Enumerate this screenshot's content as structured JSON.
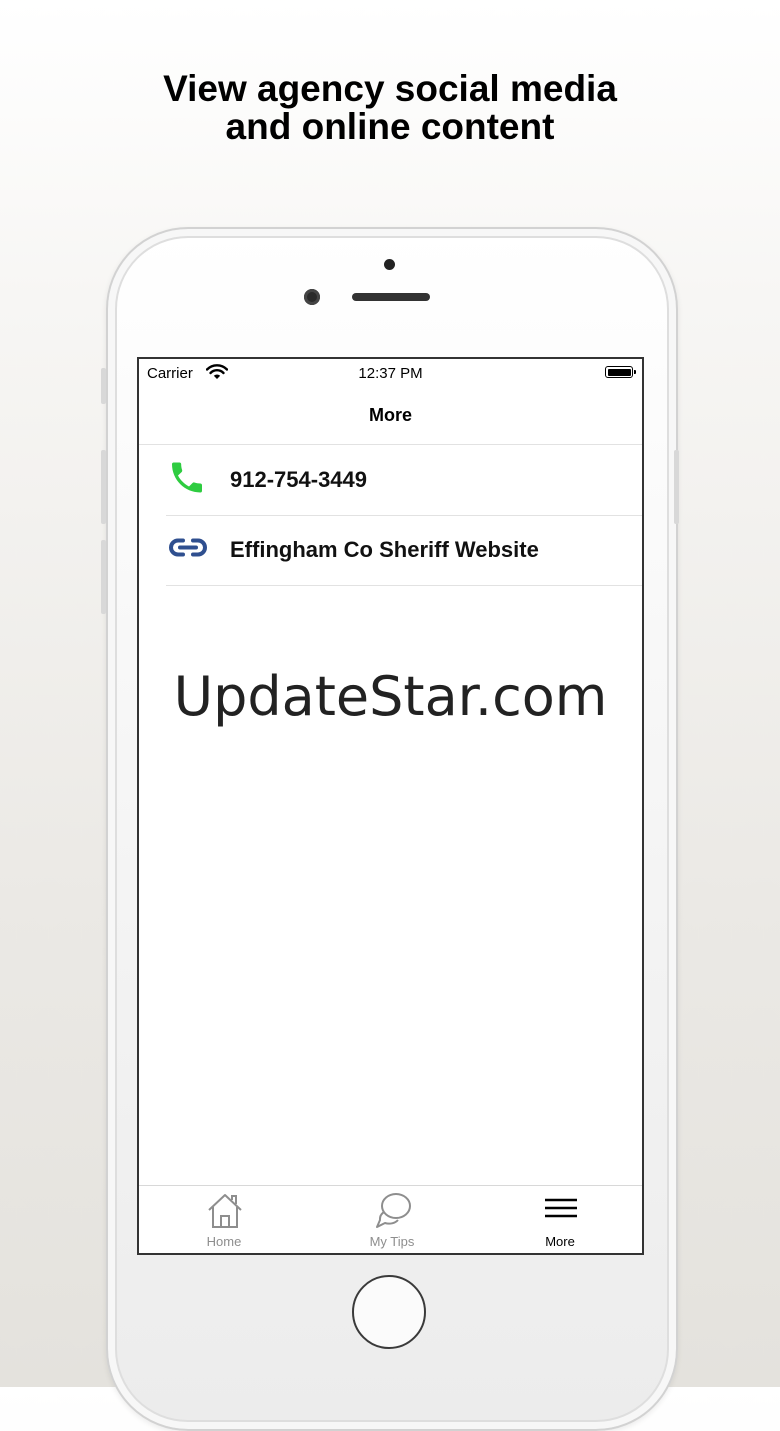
{
  "promo": {
    "headline_line1": "View agency social media",
    "headline_line2": "and online content"
  },
  "watermark": "UpdateStar.com",
  "status_bar": {
    "carrier": "Carrier",
    "time": "12:37 PM"
  },
  "nav": {
    "title": "More"
  },
  "list": {
    "items": [
      {
        "label": "912-754-3449",
        "icon": "phone-icon",
        "icon_color": "#2ecc40"
      },
      {
        "label": "Effingham Co Sheriff Website",
        "icon": "link-icon",
        "icon_color": "#2f4f8f"
      }
    ]
  },
  "tab_bar": {
    "tabs": [
      {
        "label": "Home",
        "icon": "home-icon",
        "active": false
      },
      {
        "label": "My Tips",
        "icon": "chat-bubbles-icon",
        "active": false
      },
      {
        "label": "More",
        "icon": "hamburger-menu-icon",
        "active": true
      }
    ]
  },
  "colors": {
    "active_tab": "#000000",
    "inactive_tab": "#8e8e8e"
  }
}
